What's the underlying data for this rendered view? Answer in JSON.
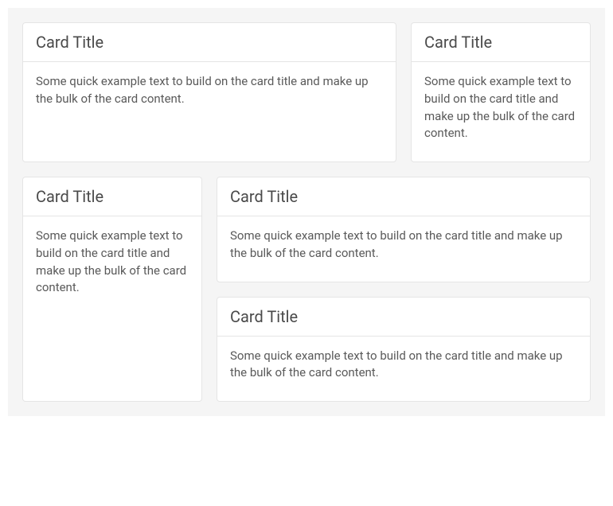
{
  "row1": {
    "cards": [
      {
        "title": "Card Title",
        "text": "Some quick example text to build on the card title and make up the bulk of the card content."
      },
      {
        "title": "Card Title",
        "text": "Some quick example text to build on the card title and make up the bulk of the card content."
      }
    ]
  },
  "row2": {
    "left": {
      "title": "Card Title",
      "text": "Some quick example text to build on the card title and make up the bulk of the card content."
    },
    "right": [
      {
        "title": "Card Title",
        "text": "Some quick example text to build on the card title and make up the bulk of the card content."
      },
      {
        "title": "Card Title",
        "text": "Some quick example text to build on the card title and make up the bulk of the card content."
      }
    ]
  }
}
